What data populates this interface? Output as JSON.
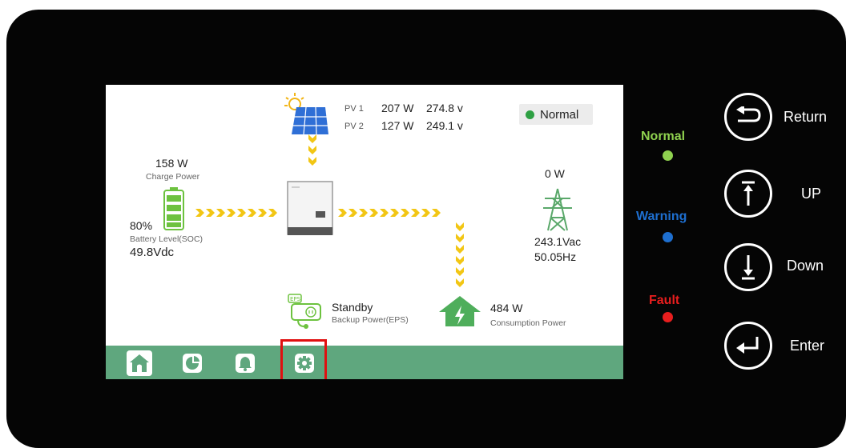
{
  "pv": {
    "pv1_label": "PV 1",
    "pv1_power": "207 W",
    "pv1_voltage": "274.8 v",
    "pv2_label": "PV 2",
    "pv2_power": "127 W",
    "pv2_voltage": "249.1 v"
  },
  "status": {
    "text": "Normal",
    "color": "#2ea043"
  },
  "battery": {
    "power": "158 W",
    "power_label": "Charge Power",
    "soc": "80%",
    "soc_label": "Battery  Level(SOC)",
    "voltage": "49.8Vdc"
  },
  "grid": {
    "power": "0 W",
    "voltage": "243.1Vac",
    "frequency": "50.05Hz"
  },
  "eps": {
    "state": "Standby",
    "label": "Backup Power(EPS)",
    "icon_text": "EPS"
  },
  "load": {
    "power": "484 W",
    "label": "Consumption Power"
  },
  "nav": {
    "items": [
      "home-icon",
      "pie-chart-icon",
      "bell-icon",
      "gear-icon"
    ],
    "selected": "gear-icon",
    "bar_color": "#5fa77e"
  },
  "leds": [
    {
      "label": "Normal",
      "color": "#8fd14f"
    },
    {
      "label": "Warning",
      "color": "#1e6fd0"
    },
    {
      "label": "Fault",
      "color": "#e81e1e"
    }
  ],
  "buttons": [
    {
      "label": "Return",
      "icon": "return-icon"
    },
    {
      "label": "UP",
      "icon": "arrow-up-icon"
    },
    {
      "label": "Down",
      "icon": "arrow-down-icon"
    },
    {
      "label": "Enter",
      "icon": "enter-icon"
    }
  ],
  "flow_color": "#f2c614"
}
